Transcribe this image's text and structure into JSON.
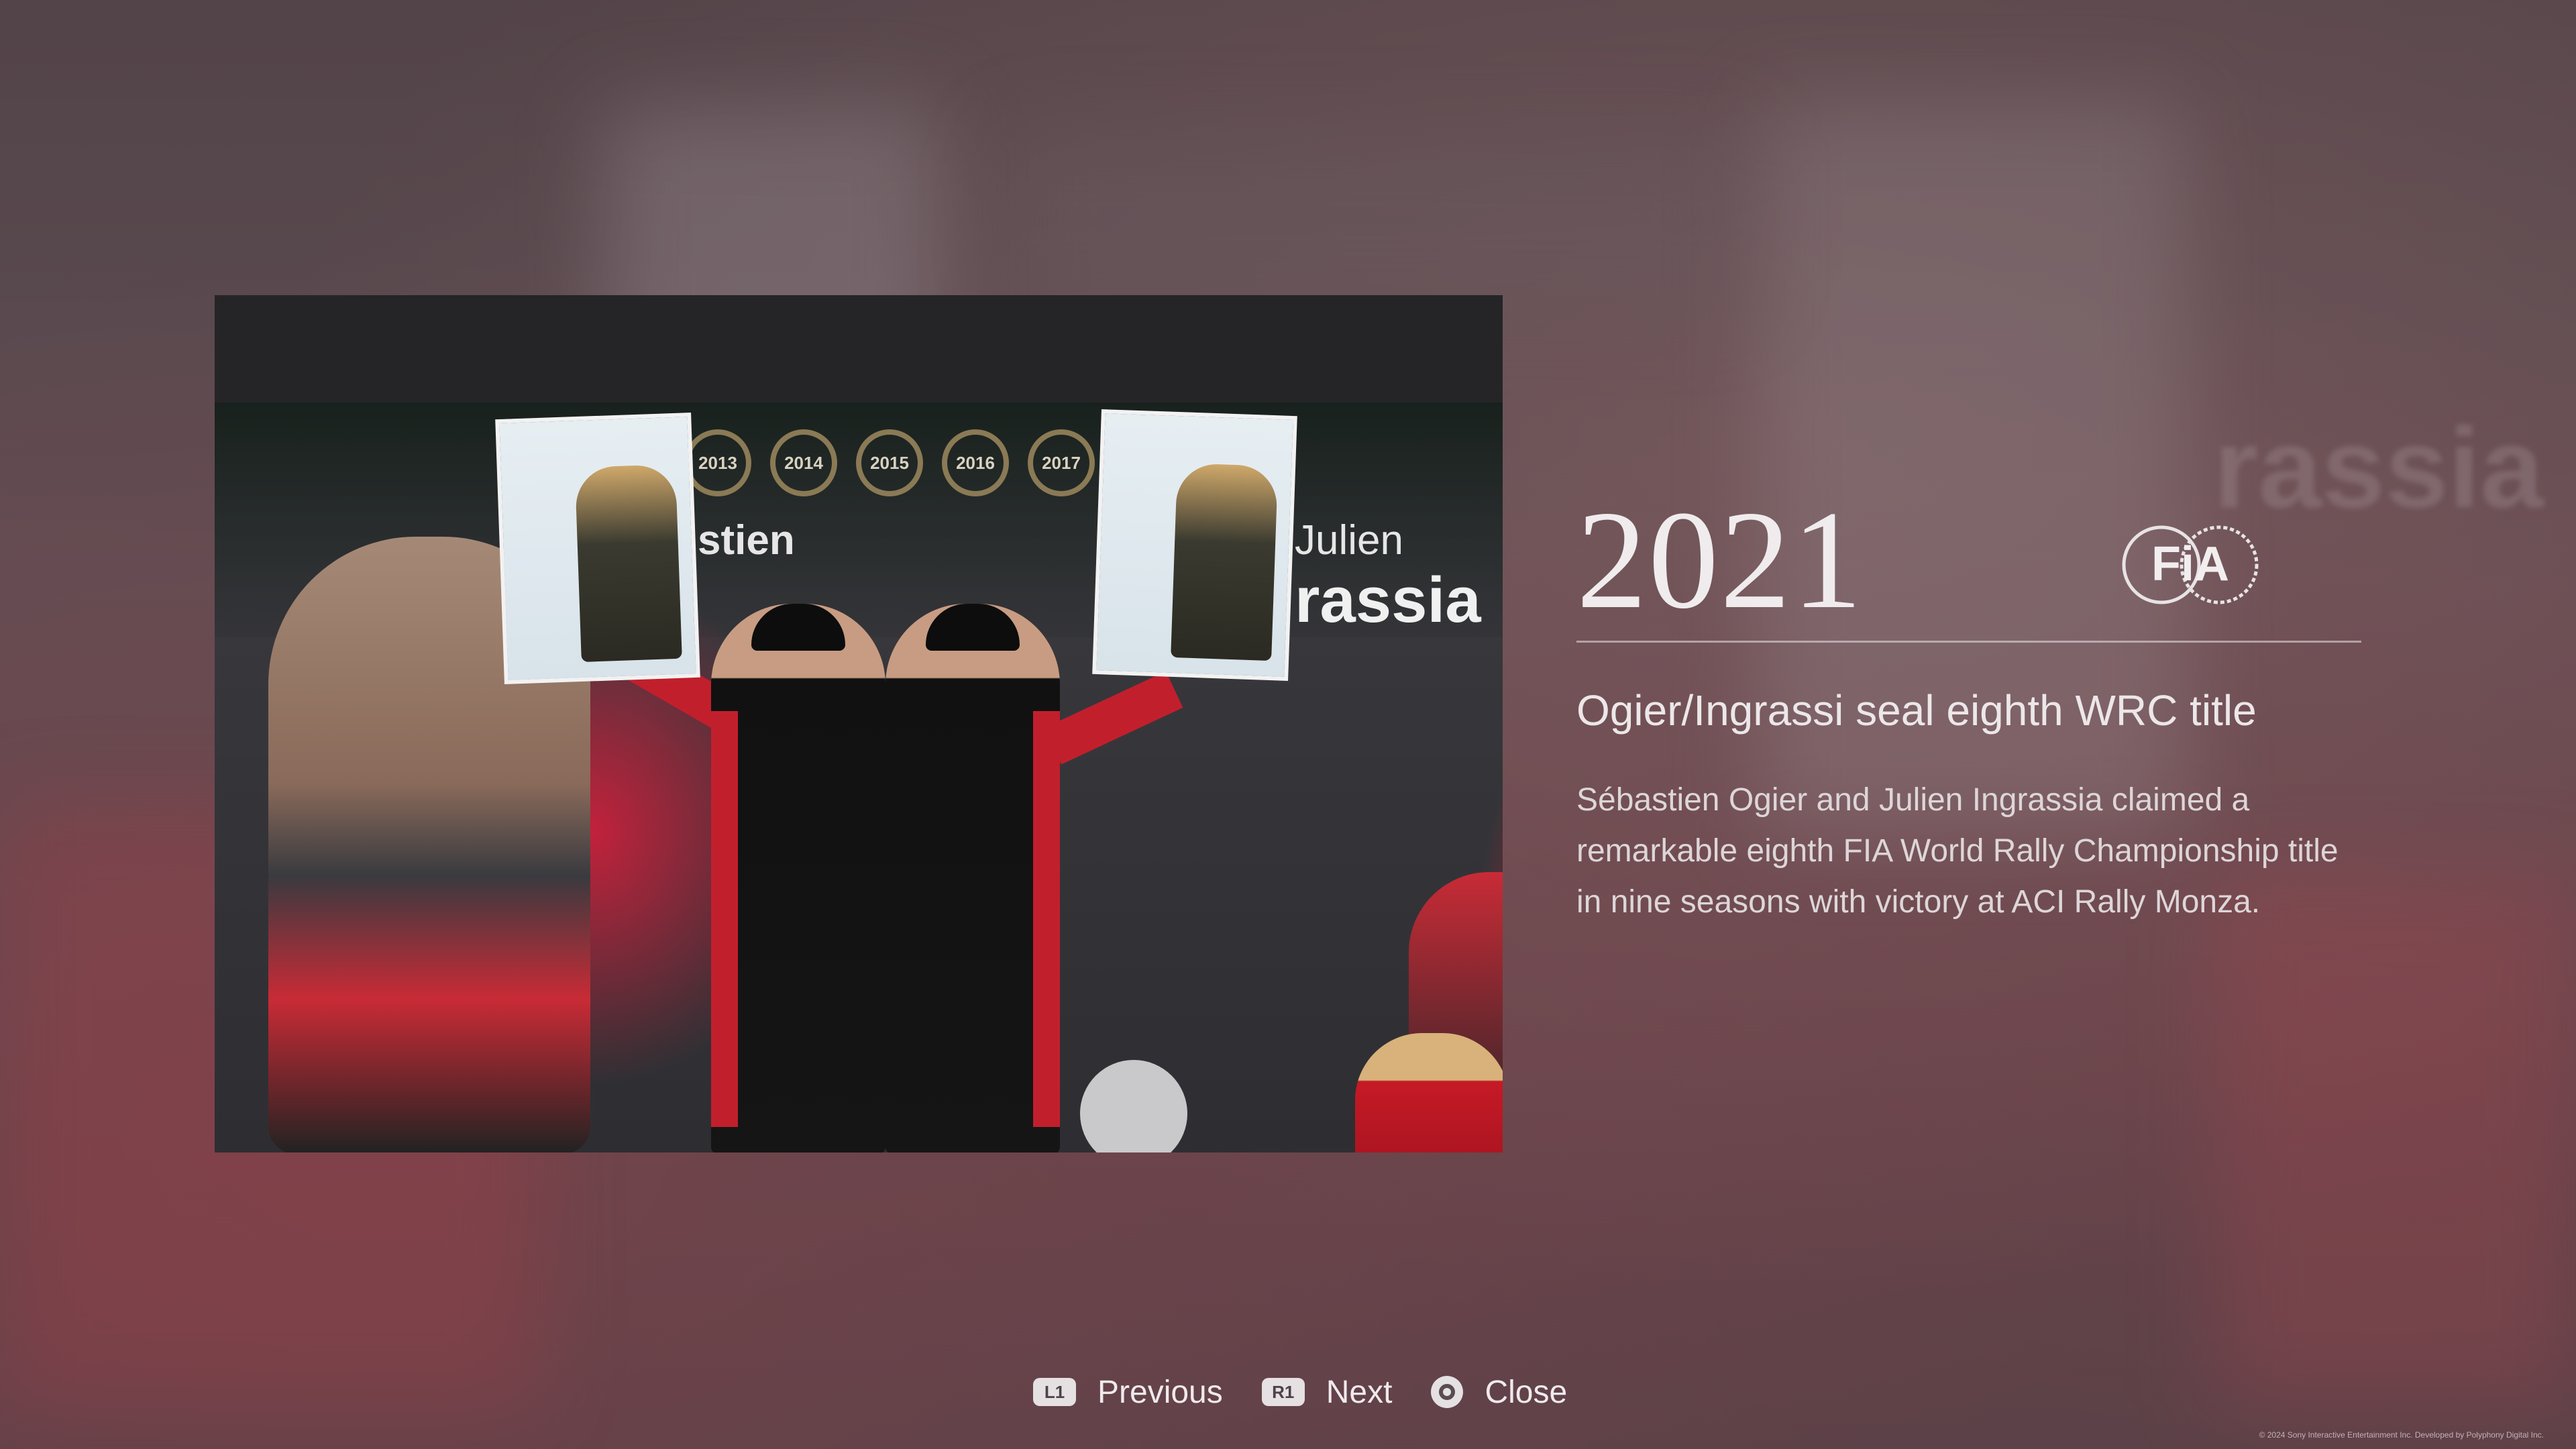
{
  "article": {
    "year": "2021",
    "headline": "Ogier/Ingrassi seal eighth WRC title",
    "body": "Sébastien Ogier and Julien Ingrassia claimed a remarkable eighth FIA World Rally Championship title in nine seasons with victory at ACI Rally Monza.",
    "logo_text": "FiA"
  },
  "photo": {
    "laurel_years": [
      "2013",
      "2014",
      "2015",
      "2016",
      "2017"
    ],
    "screen_name_left": "stien",
    "screen_name_right_first": "Julien",
    "screen_name_right_last": "rassia"
  },
  "controls": {
    "previous": {
      "glyph": "L1",
      "label": "Previous"
    },
    "next": {
      "glyph": "R1",
      "label": "Next"
    },
    "close": {
      "label": "Close"
    }
  },
  "footer": {
    "copyright": "© 2024 Sony Interactive Entertainment Inc. Developed by Polyphony Digital Inc."
  },
  "colors": {
    "background": "#5b4d51",
    "text": "#e9e4e6",
    "accent_red": "#c21f2d"
  }
}
